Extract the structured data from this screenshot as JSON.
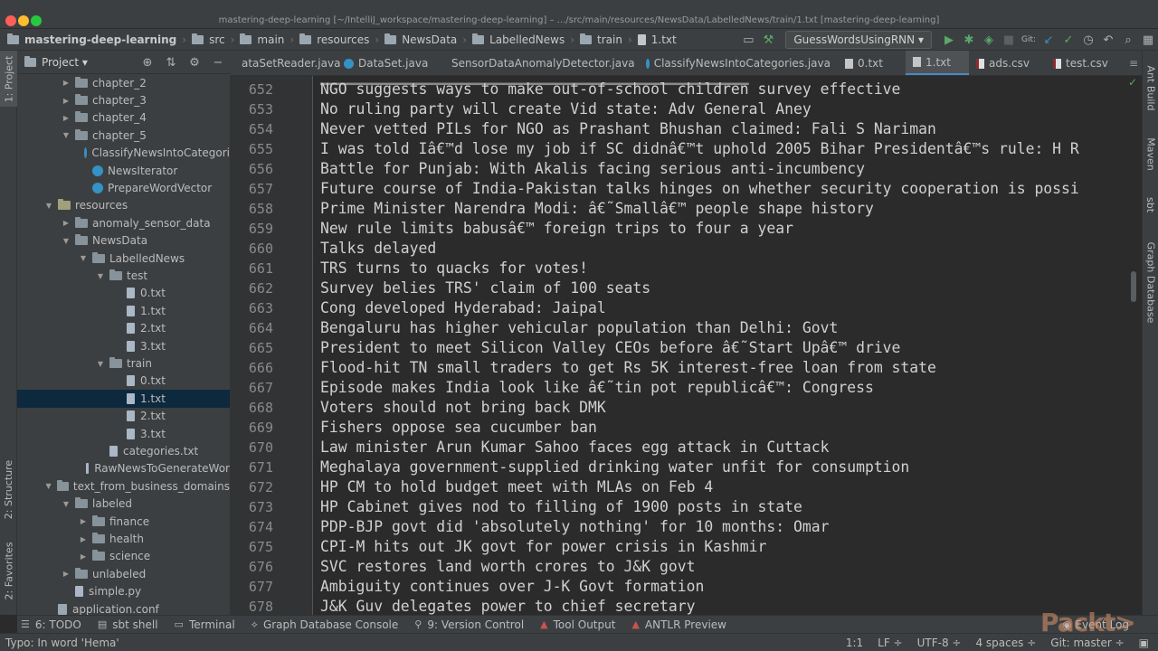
{
  "window": {
    "title": "mastering-deep-learning [~/IntelliJ_workspace/mastering-deep-learning] – .../src/main/resources/NewsData/LabelledNews/train/1.txt [mastering-deep-learning]"
  },
  "navbar": {
    "breadcrumbs": [
      "mastering-deep-learning",
      "src",
      "main",
      "resources",
      "NewsData",
      "LabelledNews",
      "train",
      "1.txt"
    ],
    "run_config": "GuessWordsUsingRNN",
    "vcs_label": "Git:"
  },
  "left_strip": {
    "tabs": [
      "1: Project",
      "2: Structure",
      "2: Favorites"
    ]
  },
  "right_strip": {
    "tabs": [
      "Ant Build",
      "Maven",
      "sbt",
      "Graph Database"
    ]
  },
  "project_panel": {
    "title": "Project",
    "tree": [
      {
        "label": "chapter_2",
        "kind": "folder",
        "level": 2,
        "expanded": false
      },
      {
        "label": "chapter_3",
        "kind": "folder",
        "level": 2,
        "expanded": false
      },
      {
        "label": "chapter_4",
        "kind": "folder",
        "level": 2,
        "expanded": false
      },
      {
        "label": "chapter_5",
        "kind": "folder",
        "level": 2,
        "expanded": true
      },
      {
        "label": "ClassifyNewsIntoCategori",
        "kind": "class",
        "level": 3
      },
      {
        "label": "NewsIterator",
        "kind": "class",
        "level": 3
      },
      {
        "label": "PrepareWordVector",
        "kind": "class",
        "level": 3
      },
      {
        "label": "resources",
        "kind": "resfolder",
        "level": 1,
        "expanded": true
      },
      {
        "label": "anomaly_sensor_data",
        "kind": "folder",
        "level": 2,
        "expanded": false
      },
      {
        "label": "NewsData",
        "kind": "folder",
        "level": 2,
        "expanded": true
      },
      {
        "label": "LabelledNews",
        "kind": "folder",
        "level": 3,
        "expanded": true
      },
      {
        "label": "test",
        "kind": "folder",
        "level": 4,
        "expanded": true
      },
      {
        "label": "0.txt",
        "kind": "file",
        "level": 5
      },
      {
        "label": "1.txt",
        "kind": "file",
        "level": 5
      },
      {
        "label": "2.txt",
        "kind": "file",
        "level": 5
      },
      {
        "label": "3.txt",
        "kind": "file",
        "level": 5
      },
      {
        "label": "train",
        "kind": "folder",
        "level": 4,
        "expanded": true
      },
      {
        "label": "0.txt",
        "kind": "file",
        "level": 5
      },
      {
        "label": "1.txt",
        "kind": "file",
        "level": 5,
        "selected": true
      },
      {
        "label": "2.txt",
        "kind": "file",
        "level": 5
      },
      {
        "label": "3.txt",
        "kind": "file",
        "level": 5
      },
      {
        "label": "categories.txt",
        "kind": "file",
        "level": 4
      },
      {
        "label": "RawNewsToGenerateWor",
        "kind": "file",
        "level": 3
      },
      {
        "label": "text_from_business_domains",
        "kind": "folder",
        "level": 1,
        "expanded": true
      },
      {
        "label": "labeled",
        "kind": "folder",
        "level": 2,
        "expanded": true
      },
      {
        "label": "finance",
        "kind": "folder",
        "level": 3,
        "expanded": false
      },
      {
        "label": "health",
        "kind": "folder",
        "level": 3,
        "expanded": false
      },
      {
        "label": "science",
        "kind": "folder",
        "level": 3,
        "expanded": false
      },
      {
        "label": "unlabeled",
        "kind": "folder",
        "level": 2,
        "expanded": false
      },
      {
        "label": "simple.py",
        "kind": "pyfile",
        "level": 2
      },
      {
        "label": "application.conf",
        "kind": "conf",
        "level": 1
      }
    ]
  },
  "editor_tabs": [
    {
      "label": "ataSetReader.java",
      "kind": "class"
    },
    {
      "label": "DataSet.java",
      "kind": "class"
    },
    {
      "label": "SensorDataAnomalyDetector.java",
      "kind": "class"
    },
    {
      "label": "ClassifyNewsIntoCategories.java",
      "kind": "class"
    },
    {
      "label": "0.txt",
      "kind": "file"
    },
    {
      "label": "1.txt",
      "kind": "file",
      "active": true
    },
    {
      "label": "ads.csv",
      "kind": "csv"
    },
    {
      "label": "test.csv",
      "kind": "csv"
    }
  ],
  "editor": {
    "lines": [
      {
        "n": "652",
        "text": "NGO suggests ways to make out-of-school children survey effective"
      },
      {
        "n": "653",
        "text": "No ruling party will create Vid state: Adv General Aney"
      },
      {
        "n": "654",
        "text": "Never vetted PILs for NGO as Prashant Bhushan claimed: Fali S Nariman"
      },
      {
        "n": "655",
        "text": "I was told Iâ€™d lose my job if SC didnâ€™t uphold 2005 Bihar Presidentâ€™s rule: H R"
      },
      {
        "n": "656",
        "text": "Battle for Punjab: With Akalis facing serious anti-incumbency"
      },
      {
        "n": "657",
        "text": "Future course of India-Pakistan talks hinges on whether security cooperation is possi"
      },
      {
        "n": "658",
        "text": "Prime Minister Narendra Modi: â€˜Smallâ€™ people shape history"
      },
      {
        "n": "659",
        "text": "New rule limits babusâ€™ foreign trips to four a year"
      },
      {
        "n": "660",
        "text": "Talks delayed"
      },
      {
        "n": "661",
        "text": "TRS turns to quacks for votes!"
      },
      {
        "n": "662",
        "text": "Survey belies TRS' claim of 100 seats"
      },
      {
        "n": "663",
        "text": "Cong developed Hyderabad: Jaipal"
      },
      {
        "n": "664",
        "text": "Bengaluru has higher vehicular population than Delhi: Govt"
      },
      {
        "n": "665",
        "text": "President to meet Silicon Valley CEOs before â€˜Start Upâ€™ drive"
      },
      {
        "n": "666",
        "text": "Flood-hit TN small traders to get Rs 5K interest-free loan from state"
      },
      {
        "n": "667",
        "text": "Episode makes India look like â€˜tin pot republicâ€™: Congress"
      },
      {
        "n": "668",
        "text": "Voters should not bring back DMK"
      },
      {
        "n": "669",
        "text": "Fishers oppose sea cucumber ban"
      },
      {
        "n": "670",
        "text": "Law minister Arun Kumar Sahoo faces egg attack in Cuttack"
      },
      {
        "n": "671",
        "text": "Meghalaya government-supplied drinking water unfit for consumption"
      },
      {
        "n": "672",
        "text": "HP CM to hold budget meet with MLAs on Feb 4"
      },
      {
        "n": "673",
        "text": "HP Cabinet gives nod to filling of 1900 posts in state"
      },
      {
        "n": "674",
        "text": "PDP-BJP govt did 'absolutely nothing' for 10 months: Omar"
      },
      {
        "n": "675",
        "text": "CPI-M hits out JK govt for power crisis in Kashmir"
      },
      {
        "n": "676",
        "text": "SVC restores land worth crores to J&K govt"
      },
      {
        "n": "677",
        "text": "Ambiguity continues over J-K Govt formation"
      },
      {
        "n": "678",
        "text": "J&K Guv delegates power to chief secretary"
      }
    ]
  },
  "bottom_tools": [
    {
      "label": "6: TODO"
    },
    {
      "label": "sbt shell"
    },
    {
      "label": "Terminal"
    },
    {
      "label": "Graph Database Console"
    },
    {
      "label": "9: Version Control"
    },
    {
      "label": "Tool Output"
    },
    {
      "label": "ANTLR Preview"
    }
  ],
  "event_log": "Event Log",
  "status": {
    "message": "Typo: In word 'Hema'",
    "position": "1:1",
    "line_sep": "LF ÷",
    "encoding": "UTF-8 ÷",
    "indent": "4 spaces ÷",
    "git_branch": "Git: master ÷"
  },
  "watermark": "Packt>"
}
